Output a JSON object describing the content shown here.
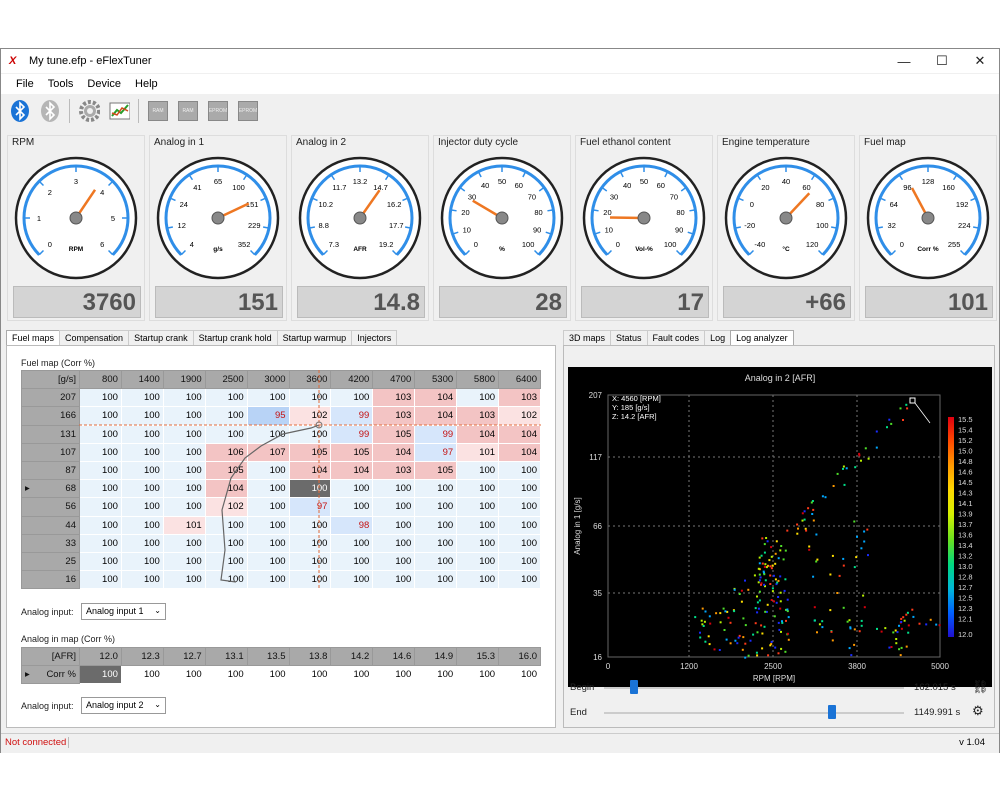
{
  "window": {
    "title": "My tune.efp - eFlexTuner",
    "minimize": "—",
    "maximize": "☐",
    "close": "✕",
    "app_icon": "X"
  },
  "menu": [
    "File",
    "Tools",
    "Device",
    "Help"
  ],
  "toolbar": {
    "icons": [
      "bluetooth-connect-icon",
      "bluetooth-disconnect-icon",
      "settings-gear-icon",
      "chart-wizard-icon",
      "ram-read-icon",
      "ram-write-icon",
      "eprom-read-icon",
      "eprom-write-icon"
    ],
    "chips": [
      "RAM",
      "RAM",
      "EPROM",
      "EPROM"
    ]
  },
  "gauges": [
    {
      "label": "RPM",
      "ticks": [
        "0",
        "1",
        "2",
        "3",
        "4",
        "5",
        "6"
      ],
      "unit": "RPM",
      "value": "3760",
      "needle": 0.626
    },
    {
      "label": "Analog in 1",
      "ticks": [
        "4",
        "12",
        "24",
        "41",
        "65",
        "100",
        "151",
        "229",
        "352"
      ],
      "unit": "g/s",
      "value": "151",
      "needle": 0.74
    },
    {
      "label": "Analog in 2",
      "ticks": [
        "7.3",
        "8.8",
        "10.2",
        "11.7",
        "13.2",
        "14.7",
        "16.2",
        "17.7",
        "19.2"
      ],
      "unit": "AFR",
      "value": "14.8",
      "needle": 0.63
    },
    {
      "label": "Injector duty cycle",
      "ticks": [
        "0",
        "10",
        "20",
        "30",
        "40",
        "50",
        "60",
        "70",
        "80",
        "90",
        "100"
      ],
      "unit": "%",
      "value": "28",
      "needle": 0.28
    },
    {
      "label": "Fuel ethanol content",
      "ticks": [
        "0",
        "10",
        "20",
        "30",
        "40",
        "50",
        "60",
        "70",
        "80",
        "90",
        "100"
      ],
      "unit": "Vol-%",
      "value": "17",
      "needle": 0.17
    },
    {
      "label": "Engine temperature",
      "ticks": [
        "-40",
        "-20",
        "0",
        "20",
        "40",
        "60",
        "80",
        "100",
        "120"
      ],
      "unit": "°C",
      "value": "+66",
      "needle": 0.66
    },
    {
      "label": "Fuel map",
      "ticks": [
        "0",
        "32",
        "64",
        "96",
        "128",
        "160",
        "192",
        "224",
        "255"
      ],
      "unit": "Corr %",
      "value": "101",
      "needle": 0.396
    }
  ],
  "left_tabs": [
    "Fuel maps",
    "Compensation",
    "Startup crank",
    "Startup crank hold",
    "Startup warmup",
    "Injectors"
  ],
  "right_tabs": [
    "3D maps",
    "Status",
    "Fault codes",
    "Log",
    "Log analyzer"
  ],
  "fuel_map": {
    "title": "Fuel map (Corr %)",
    "corner": "[g/s]",
    "columns": [
      "800",
      "1400",
      "1900",
      "2500",
      "3000",
      "3600",
      "4200",
      "4700",
      "5300",
      "5800",
      "6400"
    ],
    "rows": [
      {
        "h": "207",
        "v": [
          "100",
          "100",
          "100",
          "100",
          "100",
          "100",
          "100",
          "103",
          "104",
          "100",
          "103"
        ]
      },
      {
        "h": "166",
        "v": [
          "100",
          "100",
          "100",
          "100",
          "95",
          "102",
          "99",
          "103",
          "104",
          "103",
          "102"
        ]
      },
      {
        "h": "131",
        "v": [
          "100",
          "100",
          "100",
          "100",
          "100",
          "100",
          "99",
          "105",
          "99",
          "104",
          "104"
        ]
      },
      {
        "h": "107",
        "v": [
          "100",
          "100",
          "100",
          "106",
          "107",
          "105",
          "105",
          "104",
          "97",
          "101",
          "104"
        ]
      },
      {
        "h": "87",
        "v": [
          "100",
          "100",
          "100",
          "105",
          "100",
          "104",
          "104",
          "103",
          "105",
          "100",
          "100"
        ]
      },
      {
        "h": "68",
        "v": [
          "100",
          "100",
          "100",
          "104",
          "100",
          "100",
          "100",
          "100",
          "100",
          "100",
          "100"
        ]
      },
      {
        "h": "56",
        "v": [
          "100",
          "100",
          "100",
          "102",
          "100",
          "97",
          "100",
          "100",
          "100",
          "100",
          "100"
        ]
      },
      {
        "h": "44",
        "v": [
          "100",
          "100",
          "101",
          "100",
          "100",
          "100",
          "98",
          "100",
          "100",
          "100",
          "100"
        ]
      },
      {
        "h": "33",
        "v": [
          "100",
          "100",
          "100",
          "100",
          "100",
          "100",
          "100",
          "100",
          "100",
          "100",
          "100"
        ]
      },
      {
        "h": "25",
        "v": [
          "100",
          "100",
          "100",
          "100",
          "100",
          "100",
          "100",
          "100",
          "100",
          "100",
          "100"
        ]
      },
      {
        "h": "16",
        "v": [
          "100",
          "100",
          "100",
          "100",
          "100",
          "100",
          "100",
          "100",
          "100",
          "100",
          "100"
        ]
      }
    ],
    "current_row_marker": "▸",
    "current_row": "68"
  },
  "analog_input_1": {
    "label": "Analog input:",
    "value": "Analog input 1"
  },
  "analog_map": {
    "title": "Analog in map (Corr %)",
    "corner": "[AFR]",
    "columns": [
      "12.0",
      "12.3",
      "12.7",
      "13.1",
      "13.5",
      "13.8",
      "14.2",
      "14.6",
      "14.9",
      "15.3",
      "16.0"
    ],
    "row_header": "Corr %",
    "values": [
      "100",
      "100",
      "100",
      "100",
      "100",
      "100",
      "100",
      "100",
      "100",
      "100",
      "100"
    ]
  },
  "analog_input_2": {
    "label": "Analog input:",
    "value": "Analog input 2"
  },
  "chart_data": {
    "type": "scatter",
    "title": "Analog in 2 [AFR]",
    "xlabel": "RPM [RPM]",
    "ylabel": "Analog in 1 [g/s]",
    "x_ticks": [
      "0",
      "1200",
      "2500",
      "3800",
      "5000"
    ],
    "y_ticks": [
      "16",
      "35",
      "66",
      "117",
      "207"
    ],
    "cursor": {
      "x": "X: 4560 [RPM]",
      "y": "Y: 185 [g/s]",
      "z": "Z: 14.2 [AFR]"
    },
    "colorbar": [
      "15.5",
      "15.4",
      "15.2",
      "15.0",
      "14.8",
      "14.6",
      "14.5",
      "14.3",
      "14.1",
      "13.9",
      "13.7",
      "13.6",
      "13.4",
      "13.2",
      "13.0",
      "12.8",
      "12.7",
      "12.5",
      "12.3",
      "12.1"
    ],
    "colorbar_min": "12.0",
    "grid": true
  },
  "begin": {
    "label": "Begin",
    "value": "162.015 s",
    "pos": 0.1
  },
  "end": {
    "label": "End",
    "value": "1149.991 s",
    "pos": 0.76
  },
  "status": {
    "connection": "Not connected",
    "version": "v 1.04"
  }
}
